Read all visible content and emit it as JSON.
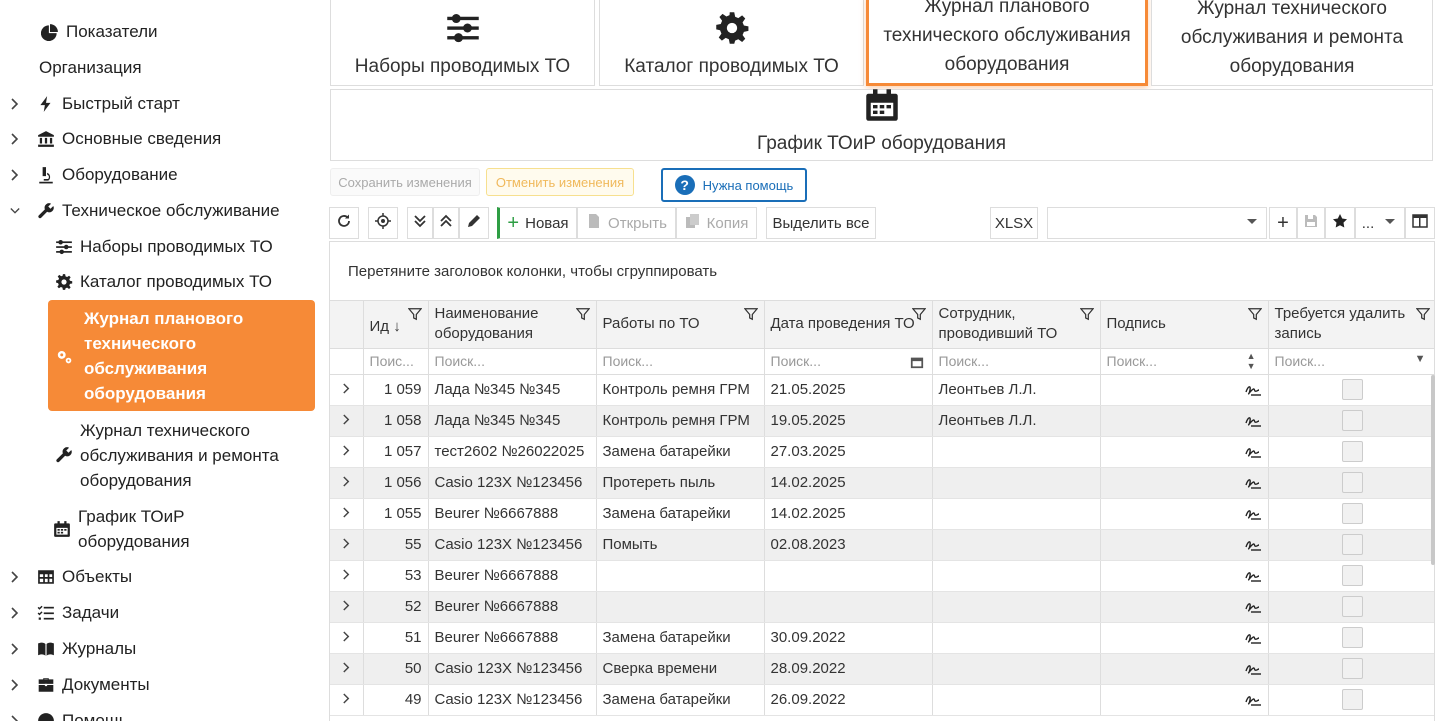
{
  "sidebar": {
    "items": [
      {
        "label": "Показатели",
        "icon": "chart-pie-icon"
      },
      {
        "label": "Организация"
      },
      {
        "label": "Быстрый старт",
        "icon": "bolt-icon"
      },
      {
        "label": "Основные сведения",
        "icon": "bank-icon"
      },
      {
        "label": "Оборудование",
        "icon": "microscope-icon"
      },
      {
        "label": "Техническое обслуживание",
        "icon": "wrench-icon"
      },
      {
        "label": "Наборы проводимых ТО",
        "icon": "sliders-icon"
      },
      {
        "label": "Каталог проводимых ТО",
        "icon": "gear-icon"
      },
      {
        "label": "Журнал планового технического обслуживания оборудования",
        "icon": "gears-icon"
      },
      {
        "label": "Журнал технического обслуживания и ремонта оборудования",
        "icon": "wrench-icon"
      },
      {
        "label": "График ТОиР оборудования",
        "icon": "calendar-icon"
      },
      {
        "label": "Объекты",
        "icon": "table-icon"
      },
      {
        "label": "Задачи",
        "icon": "tasks-icon"
      },
      {
        "label": "Журналы",
        "icon": "book-icon"
      },
      {
        "label": "Документы",
        "icon": "briefcase-icon"
      },
      {
        "label": "Помощь",
        "icon": "help-icon"
      }
    ]
  },
  "tiles": [
    {
      "label": "Наборы проводимых ТО",
      "icon": "sliders-icon"
    },
    {
      "label": "Каталог проводимых ТО",
      "icon": "gear-icon"
    },
    {
      "label": "Журнал планового технического обслуживания оборудования",
      "active": true
    },
    {
      "label": "Журнал технического обслуживания и ремонта оборудования"
    },
    {
      "label": "График ТОиР оборудования",
      "icon": "calendar-icon"
    }
  ],
  "actions": {
    "save": "Сохранить изменения",
    "cancel": "Отменить изменения",
    "help": "Нужна помощь"
  },
  "toolbar": {
    "new": "Новая",
    "open": "Открыть",
    "copy": "Копия",
    "select_all": "Выделить все",
    "xlsx": "XLSX",
    "more": "..."
  },
  "grid": {
    "group_hint": "Перетяните заголовок колонки, чтобы сгруппировать",
    "columns": [
      {
        "label": "Ид"
      },
      {
        "label": "Наименование оборудования"
      },
      {
        "label": "Работы по ТО"
      },
      {
        "label": "Дата проведения ТО"
      },
      {
        "label": "Сотрудник, проводивший ТО"
      },
      {
        "label": "Подпись"
      },
      {
        "label": "Требуется удалить запись"
      }
    ],
    "filter_placeholders": [
      "Поис...",
      "Поиск...",
      "Поиск...",
      "Поиск...",
      "Поиск...",
      "Поиск...",
      "Поиск..."
    ],
    "rows": [
      {
        "id": "1 059",
        "name": "Лада №345 №345",
        "work": "Контроль ремня ГРМ",
        "date": "21.05.2025",
        "employee": "Леонтьев Л.Л."
      },
      {
        "id": "1 058",
        "name": "Лада №345 №345",
        "work": "Контроль ремня ГРМ",
        "date": "19.05.2025",
        "employee": "Леонтьев Л.Л."
      },
      {
        "id": "1 057",
        "name": "тест2602 №26022025",
        "work": "Замена батарейки",
        "date": "27.03.2025",
        "employee": ""
      },
      {
        "id": "1 056",
        "name": "Casio 123X №123456",
        "work": "Протереть пыль",
        "date": "14.02.2025",
        "employee": ""
      },
      {
        "id": "1 055",
        "name": "Beurer №6667888",
        "work": "Замена батарейки",
        "date": "14.02.2025",
        "employee": ""
      },
      {
        "id": "55",
        "name": "Casio 123X №123456",
        "work": "Помыть",
        "date": "02.08.2023",
        "employee": ""
      },
      {
        "id": "53",
        "name": "Beurer №6667888",
        "work": "",
        "date": "",
        "employee": ""
      },
      {
        "id": "52",
        "name": "Beurer №6667888",
        "work": "",
        "date": "",
        "employee": ""
      },
      {
        "id": "51",
        "name": "Beurer №6667888",
        "work": "Замена батарейки",
        "date": "30.09.2022",
        "employee": ""
      },
      {
        "id": "50",
        "name": "Casio 123X №123456",
        "work": "Сверка времени",
        "date": "28.09.2022",
        "employee": ""
      },
      {
        "id": "49",
        "name": "Casio 123X №123456",
        "work": "Замена батарейки",
        "date": "26.09.2022",
        "employee": ""
      }
    ]
  },
  "colors": {
    "accent": "#f68a37",
    "help": "#1a6eb8",
    "new": "#2e9e44"
  }
}
